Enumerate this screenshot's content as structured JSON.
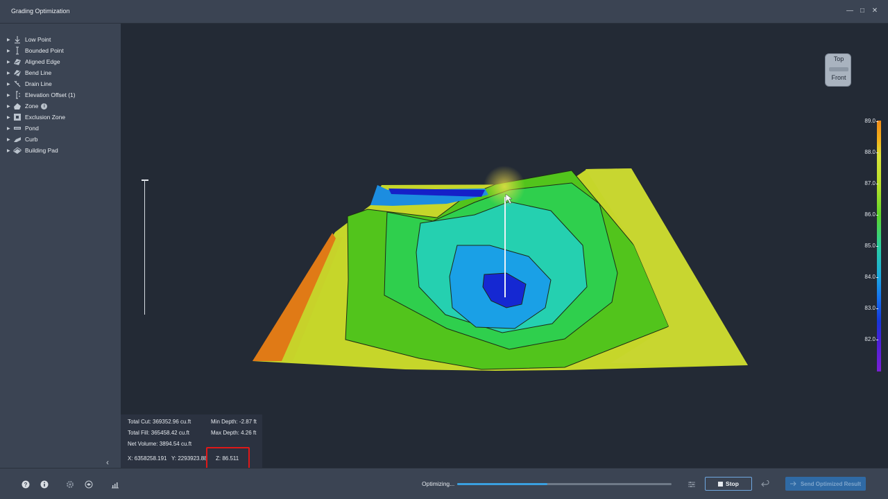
{
  "window": {
    "title": "Grading Optimization",
    "controls": [
      "minimize-icon",
      "maximize-icon",
      "close-icon"
    ]
  },
  "sidebar": {
    "items": [
      {
        "label": "Low Point",
        "icon": "low-point-icon"
      },
      {
        "label": "Bounded Point",
        "icon": "bounded-point-icon"
      },
      {
        "label": "Aligned Edge",
        "icon": "aligned-edge-icon"
      },
      {
        "label": "Bend Line",
        "icon": "bend-line-icon"
      },
      {
        "label": "Drain Line",
        "icon": "drain-line-icon"
      },
      {
        "label": "Elevation Offset (1)",
        "icon": "elevation-offset-icon"
      },
      {
        "label": "Zone",
        "icon": "zone-icon"
      },
      {
        "label": "Exclusion Zone",
        "icon": "exclusion-zone-icon"
      },
      {
        "label": "Pond",
        "icon": "pond-icon"
      },
      {
        "label": "Curb",
        "icon": "curb-icon"
      },
      {
        "label": "Building Pad",
        "icon": "building-pad-icon"
      }
    ],
    "collapse_glyph": "‹"
  },
  "viewcube": {
    "top": "Top",
    "front": "Front"
  },
  "legend": {
    "ticks": [
      "89.0",
      "88.0",
      "87.0",
      "86.0",
      "85.0",
      "84.0",
      "83.0",
      "82.0"
    ]
  },
  "stats": {
    "total_cut": "Total Cut: 369352.96 cu.ft",
    "total_fill": "Total Fill: 365458.42 cu.ft",
    "net_volume": "Net Volume: 3894.54 cu.ft",
    "min_depth": "Min Depth: -2.87 ft",
    "max_depth": "Max Depth: 4.26 ft",
    "x": "X: 6358258.191",
    "y": "Y: 2293923.88",
    "z": "Z: 86.511"
  },
  "bottombar": {
    "left_icons": [
      "help-icon",
      "info-icon",
      "settings-icon",
      "layers-icon",
      "chart-icon"
    ],
    "progress_label": "Optimizing...",
    "progress": 0.42,
    "stop_label": "Stop",
    "send_label": "Send Optimized Result"
  },
  "colors": {
    "panel": "#3b4453",
    "viewport": "#232a35",
    "accent": "#3aa0e0",
    "highlight": "#e01818"
  }
}
